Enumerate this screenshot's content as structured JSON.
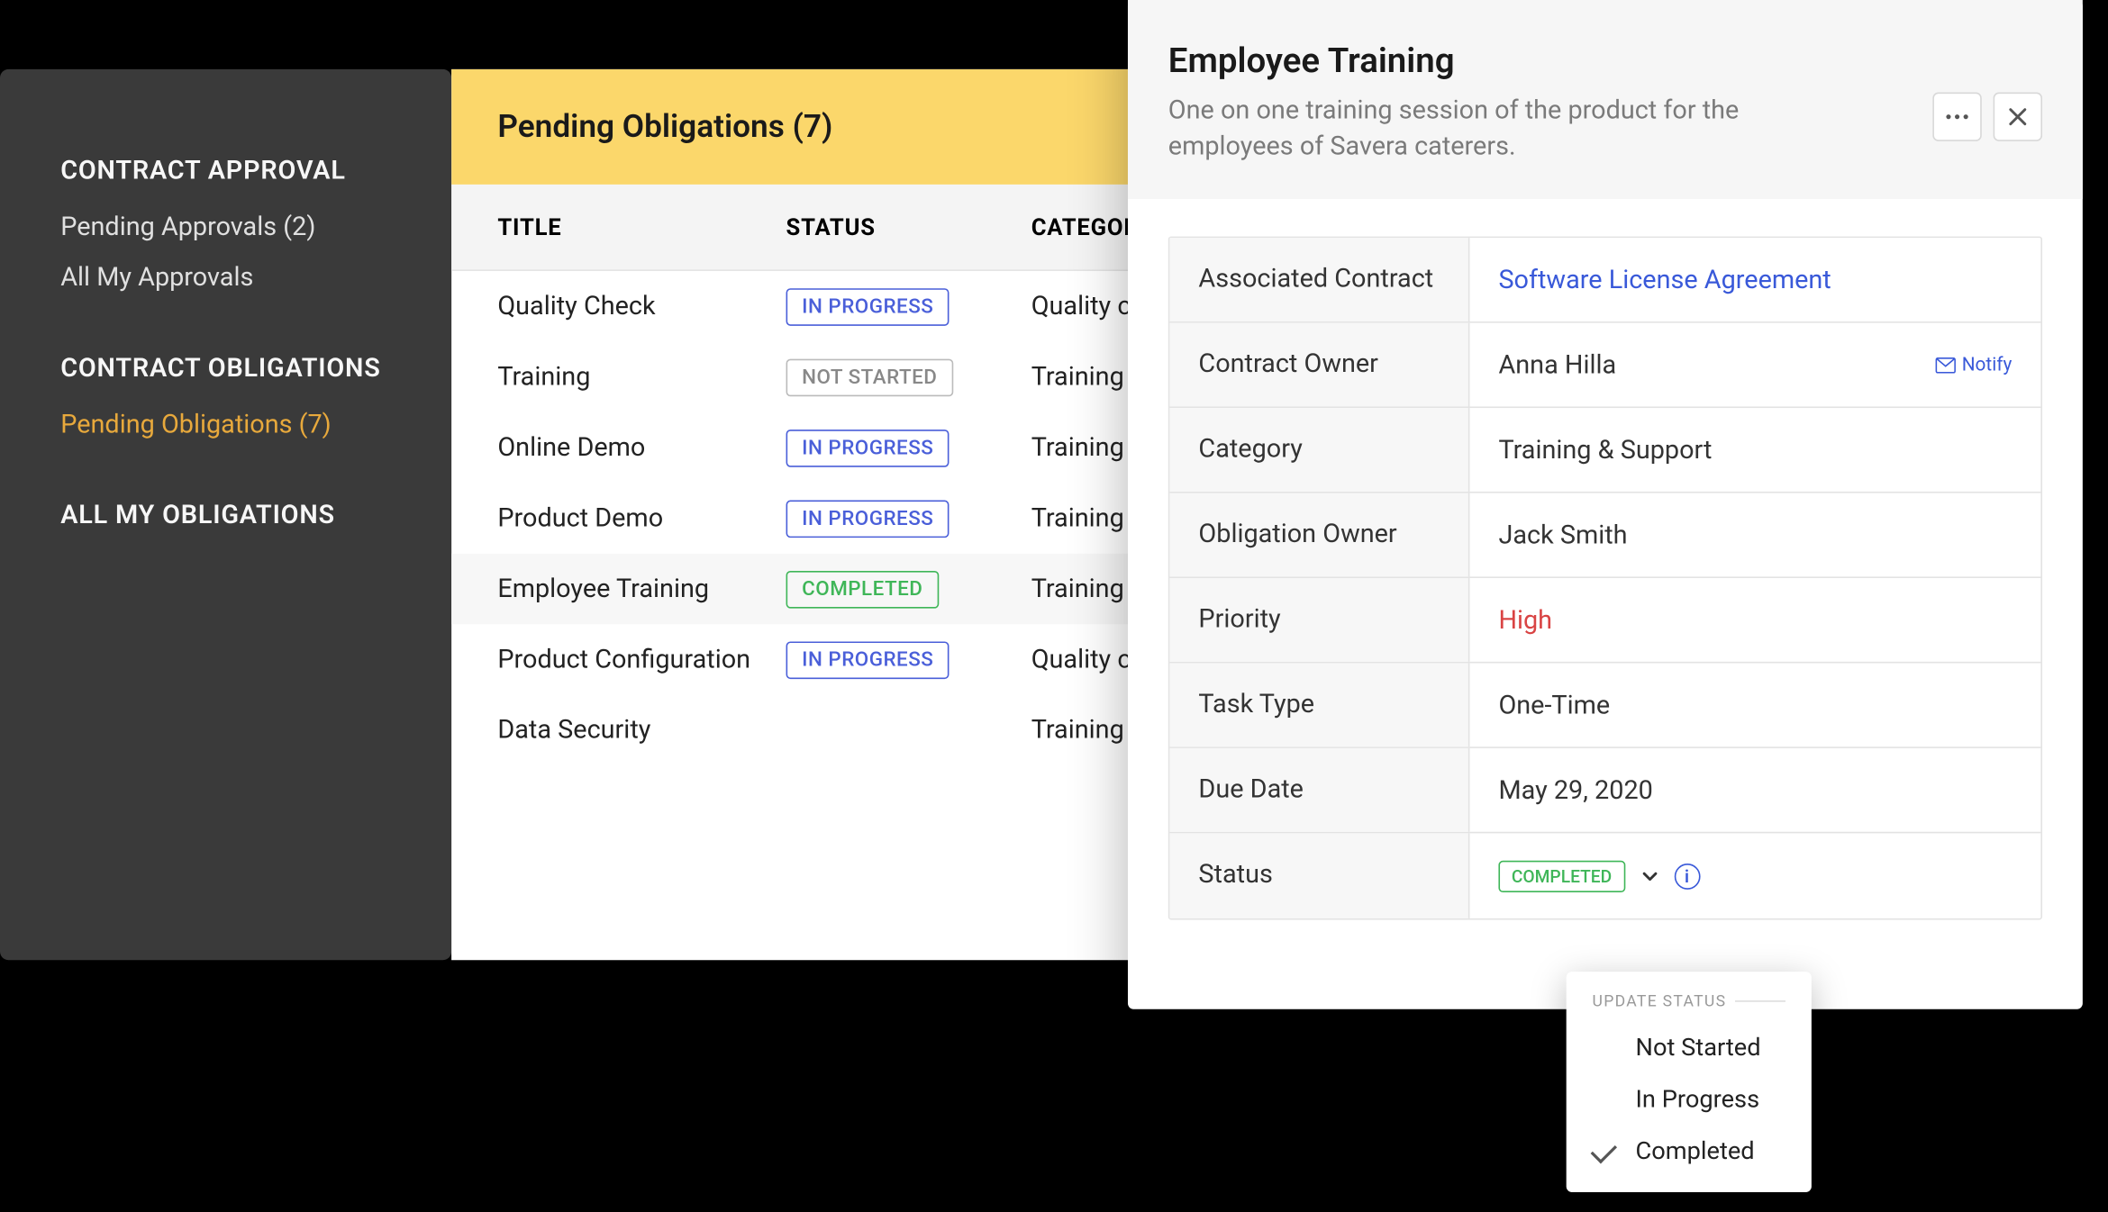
{
  "sidebar": {
    "sections": [
      {
        "heading": "CONTRACT APPROVAL",
        "items": [
          {
            "label": "Pending Approvals (2)",
            "active": false
          },
          {
            "label": "All My Approvals",
            "active": false
          }
        ]
      },
      {
        "heading": "CONTRACT OBLIGATIONS",
        "items": [
          {
            "label": "Pending Obligations (7)",
            "active": true
          }
        ]
      },
      {
        "heading": "ALL MY OBLIGATIONS",
        "items": []
      }
    ]
  },
  "main": {
    "header": "Pending Obligations (7)",
    "columns": {
      "title": "TITLE",
      "status": "STATUS",
      "category": "CATEGORY"
    },
    "rows": [
      {
        "title": "Quality Check",
        "status": "IN PROGRESS",
        "status_class": "inprogress",
        "category": "Quality check"
      },
      {
        "title": "Training",
        "status": "NOT STARTED",
        "status_class": "notstarted",
        "category": "Training & Support"
      },
      {
        "title": "Online Demo",
        "status": "IN PROGRESS",
        "status_class": "inprogress",
        "category": "Training & Support"
      },
      {
        "title": "Product Demo",
        "status": "IN PROGRESS",
        "status_class": "inprogress",
        "category": "Training & Support"
      },
      {
        "title": "Employee Training",
        "status": "COMPLETED",
        "status_class": "completed",
        "category": "Training & Support",
        "selected": true
      },
      {
        "title": "Product Configuration",
        "status": "IN PROGRESS",
        "status_class": "inprogress",
        "category": "Quality check"
      },
      {
        "title": "Data Security",
        "status": "",
        "status_class": "",
        "category": "Training & Support"
      }
    ]
  },
  "detail": {
    "title": "Employee Training",
    "description": "One on one training session of the product for the employees of Savera caterers.",
    "fields": [
      {
        "label": "Associated Contract",
        "value": "Software License Agreement",
        "link": true
      },
      {
        "label": "Contract Owner",
        "value": "Anna Hilla",
        "notify": true
      },
      {
        "label": "Category",
        "value": "Training & Support"
      },
      {
        "label": "Obligation Owner",
        "value": "Jack Smith"
      },
      {
        "label": "Priority",
        "value": "High",
        "priority_high": true
      },
      {
        "label": "Task Type",
        "value": "One-Time"
      },
      {
        "label": "Due Date",
        "value": "May 29, 2020"
      },
      {
        "label": "Status",
        "value": "COMPLETED",
        "status_badge": true
      }
    ],
    "notify_label": "Notify"
  },
  "dropdown": {
    "header": "UPDATE STATUS",
    "items": [
      {
        "label": "Not Started",
        "checked": false
      },
      {
        "label": "In Progress",
        "checked": false
      },
      {
        "label": "Completed",
        "checked": true
      }
    ]
  }
}
